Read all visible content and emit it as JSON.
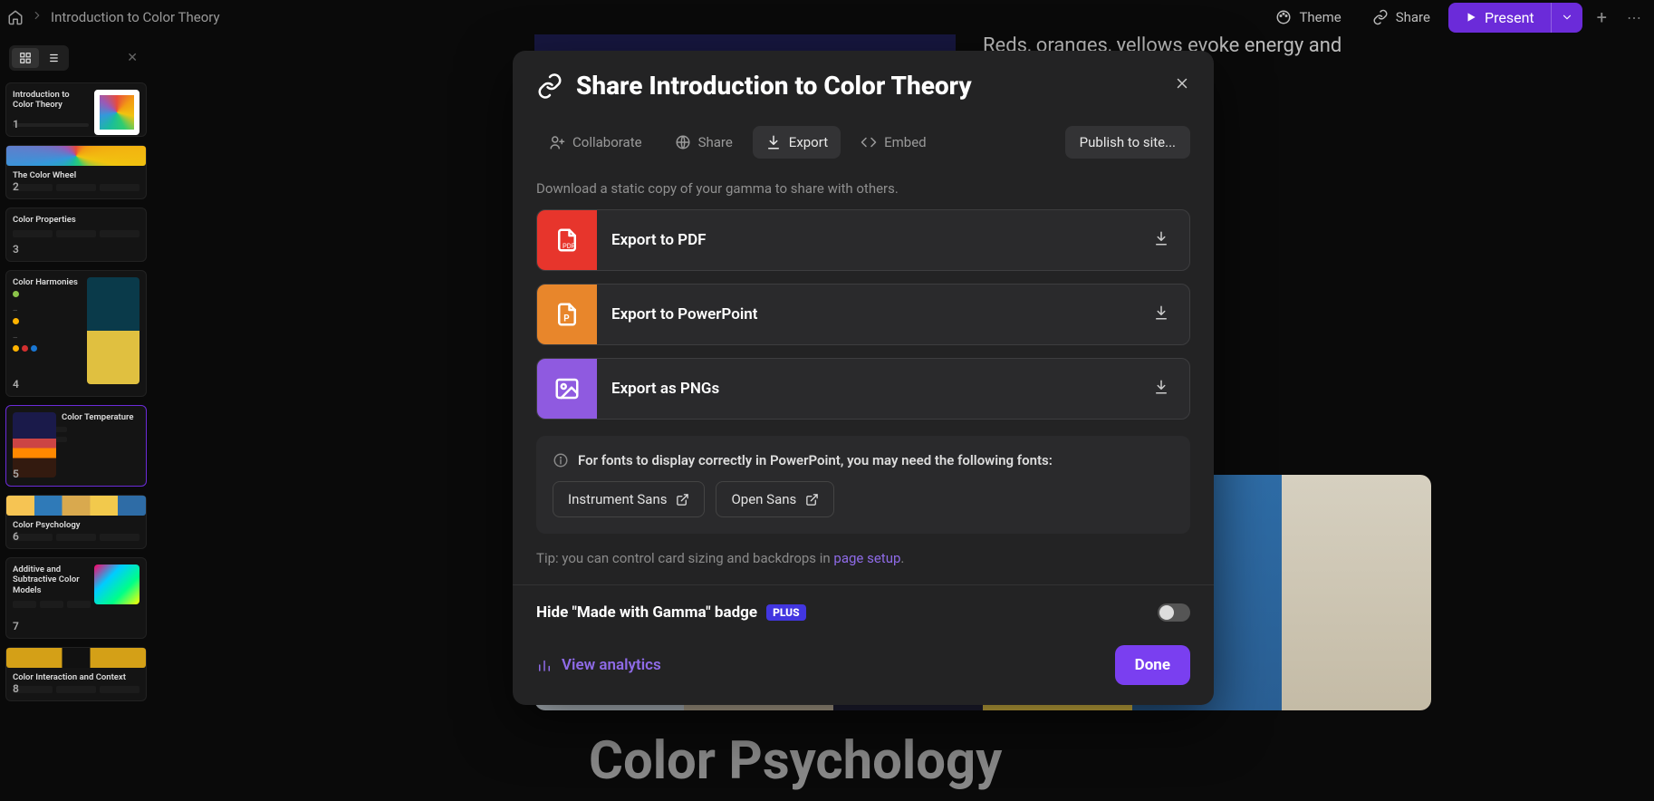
{
  "breadcrumb": {
    "title": "Introduction to Color Theory"
  },
  "topbar": {
    "theme": "Theme",
    "share": "Share",
    "present": "Present"
  },
  "sidebar": {
    "thumbs": [
      {
        "num": "1",
        "title": "Introduction to Color Theory"
      },
      {
        "num": "2",
        "title": "The Color Wheel"
      },
      {
        "num": "3",
        "title": "Color Properties"
      },
      {
        "num": "4",
        "title": "Color Harmonies"
      },
      {
        "num": "5",
        "title": "Color Temperature"
      },
      {
        "num": "6",
        "title": "Color Psychology"
      },
      {
        "num": "7",
        "title": "Additive and Subtractive Color Models"
      },
      {
        "num": "8",
        "title": "Color Interaction and Context"
      }
    ]
  },
  "canvas": {
    "peek_text": "Reds, oranges, yellows evoke energy and",
    "section_title": "Color Psychology"
  },
  "modal": {
    "title": "Share Introduction to Color Theory",
    "tabs": {
      "collaborate": "Collaborate",
      "share": "Share",
      "export": "Export",
      "embed": "Embed"
    },
    "publish": "Publish to site...",
    "desc": "Download a static copy of your gamma to share with others.",
    "export": {
      "pdf": "Export to PDF",
      "ppt": "Export to PowerPoint",
      "png": "Export as PNGs"
    },
    "font_note": "For fonts to display correctly in PowerPoint, you may need the following fonts:",
    "fonts": {
      "a": "Instrument Sans",
      "b": "Open Sans"
    },
    "tip_prefix": "Tip: you can control card sizing and backdrops in ",
    "tip_link": "page setup",
    "badge_label": "Hide \"Made with Gamma\" badge",
    "plus": "PLUS",
    "analytics": "View analytics",
    "done": "Done"
  }
}
